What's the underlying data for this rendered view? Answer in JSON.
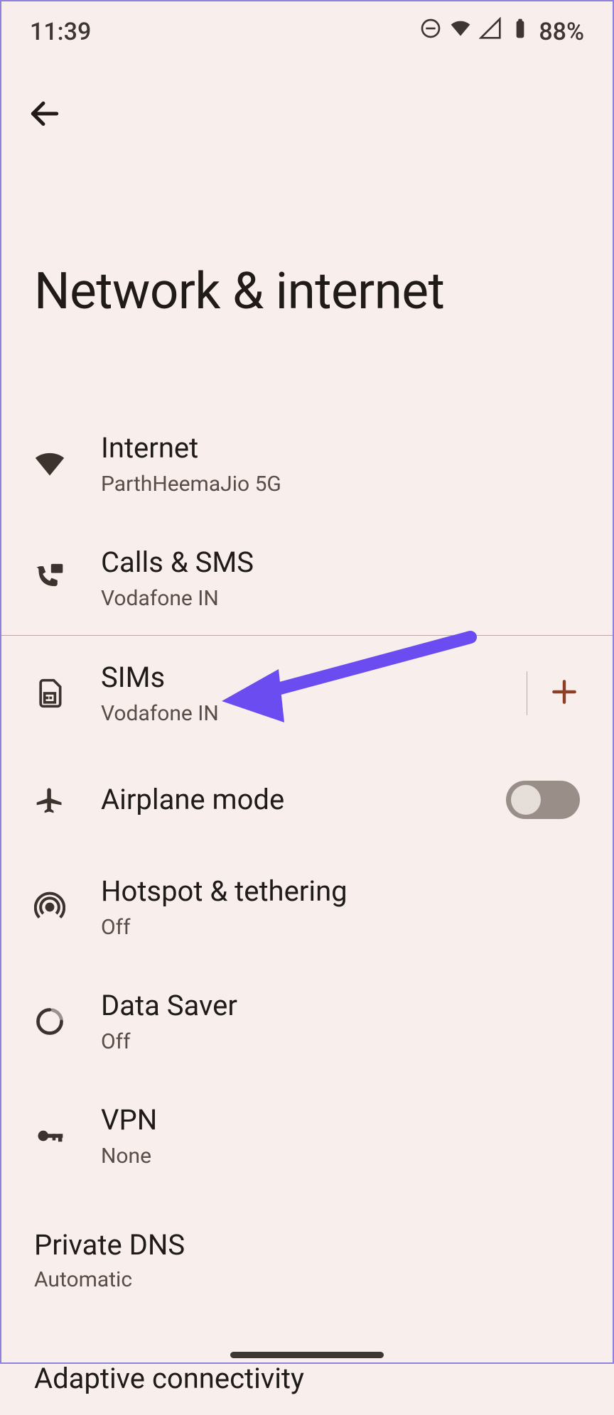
{
  "status": {
    "time": "11:39",
    "battery": "88%"
  },
  "header": {
    "title": "Network & internet"
  },
  "items": {
    "internet": {
      "title": "Internet",
      "sub": "ParthHeemaJio 5G"
    },
    "calls": {
      "title": "Calls & SMS",
      "sub": "Vodafone IN"
    },
    "sims": {
      "title": "SIMs",
      "sub": "Vodafone IN"
    },
    "airplane": {
      "title": "Airplane mode"
    },
    "hotspot": {
      "title": "Hotspot & tethering",
      "sub": "Off"
    },
    "datasaver": {
      "title": "Data Saver",
      "sub": "Off"
    },
    "vpn": {
      "title": "VPN",
      "sub": "None"
    },
    "privatedns": {
      "title": "Private DNS",
      "sub": "Automatic"
    },
    "adaptive": {
      "title": "Adaptive connectivity"
    }
  }
}
